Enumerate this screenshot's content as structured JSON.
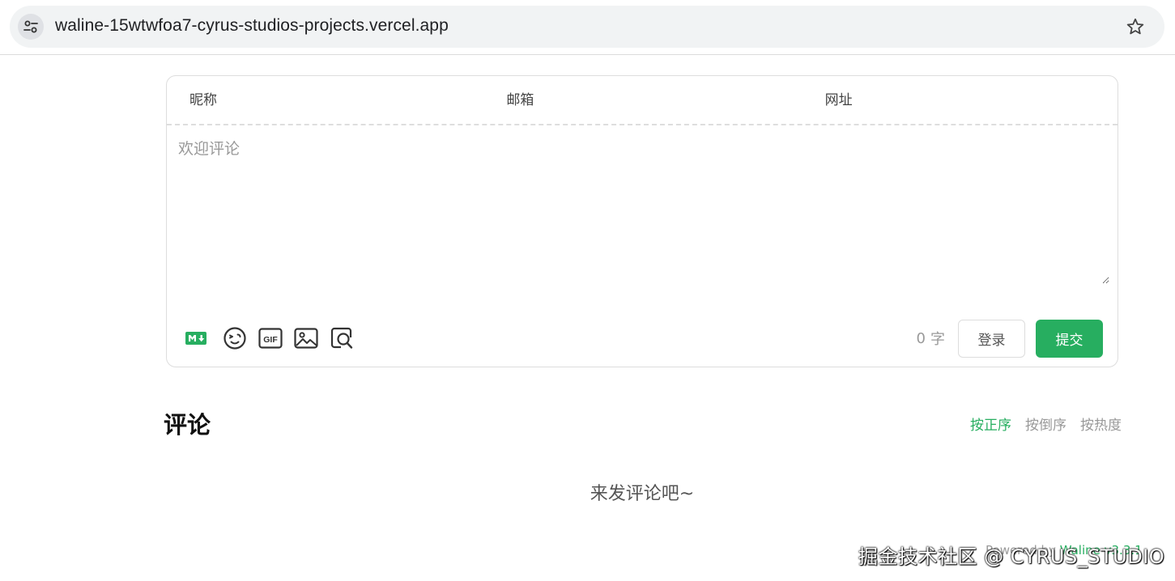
{
  "browser": {
    "url": "waline-15wtwfoa7-cyrus-studios-projects.vercel.app",
    "site_info_icon": "tune-icon",
    "bookmark_icon": "star-icon"
  },
  "form": {
    "nick_placeholder": "昵称",
    "mail_placeholder": "邮箱",
    "link_placeholder": "网址",
    "comment_placeholder": "欢迎评论",
    "comment_value": "",
    "toolbar_icons": [
      "markdown-icon",
      "emoji-icon",
      "gif-icon",
      "image-icon",
      "preview-icon"
    ],
    "word_count": "0",
    "word_unit": "字",
    "login_label": "登录",
    "submit_label": "提交"
  },
  "comments": {
    "title": "评论",
    "sort_tabs": [
      "按正序",
      "按倒序",
      "按热度"
    ],
    "active_sort": "按正序",
    "empty_message": "来发评论吧~"
  },
  "footer": {
    "powered_prefix": "Powered by",
    "powered_link": "Waline v3.3.1"
  },
  "watermark": "掘金技术社区 @ CYRUS_STUDIO",
  "colors": {
    "accent": "#27ae60",
    "border": "#dddddd",
    "muted": "#999999"
  }
}
